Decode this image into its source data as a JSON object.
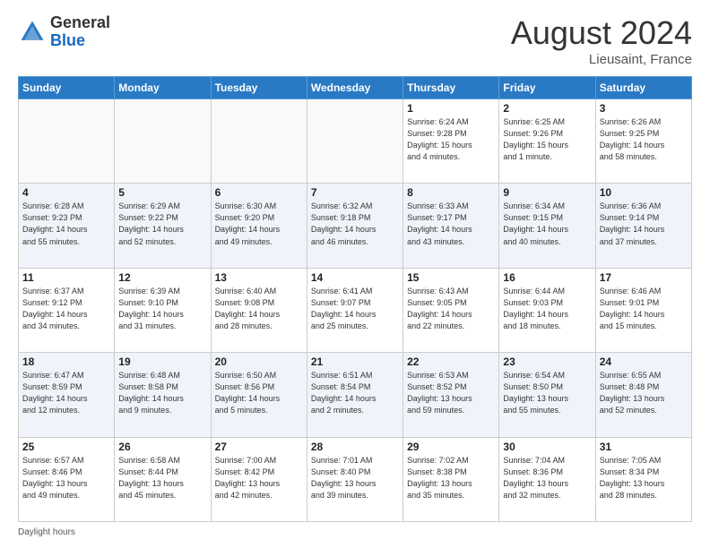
{
  "header": {
    "logo_general": "General",
    "logo_blue": "Blue",
    "month_title": "August 2024",
    "location": "Lieusaint, France"
  },
  "days_of_week": [
    "Sunday",
    "Monday",
    "Tuesday",
    "Wednesday",
    "Thursday",
    "Friday",
    "Saturday"
  ],
  "weeks": [
    [
      {
        "day": "",
        "info": ""
      },
      {
        "day": "",
        "info": ""
      },
      {
        "day": "",
        "info": ""
      },
      {
        "day": "",
        "info": ""
      },
      {
        "day": "1",
        "info": "Sunrise: 6:24 AM\nSunset: 9:28 PM\nDaylight: 15 hours\nand 4 minutes."
      },
      {
        "day": "2",
        "info": "Sunrise: 6:25 AM\nSunset: 9:26 PM\nDaylight: 15 hours\nand 1 minute."
      },
      {
        "day": "3",
        "info": "Sunrise: 6:26 AM\nSunset: 9:25 PM\nDaylight: 14 hours\nand 58 minutes."
      }
    ],
    [
      {
        "day": "4",
        "info": "Sunrise: 6:28 AM\nSunset: 9:23 PM\nDaylight: 14 hours\nand 55 minutes."
      },
      {
        "day": "5",
        "info": "Sunrise: 6:29 AM\nSunset: 9:22 PM\nDaylight: 14 hours\nand 52 minutes."
      },
      {
        "day": "6",
        "info": "Sunrise: 6:30 AM\nSunset: 9:20 PM\nDaylight: 14 hours\nand 49 minutes."
      },
      {
        "day": "7",
        "info": "Sunrise: 6:32 AM\nSunset: 9:18 PM\nDaylight: 14 hours\nand 46 minutes."
      },
      {
        "day": "8",
        "info": "Sunrise: 6:33 AM\nSunset: 9:17 PM\nDaylight: 14 hours\nand 43 minutes."
      },
      {
        "day": "9",
        "info": "Sunrise: 6:34 AM\nSunset: 9:15 PM\nDaylight: 14 hours\nand 40 minutes."
      },
      {
        "day": "10",
        "info": "Sunrise: 6:36 AM\nSunset: 9:14 PM\nDaylight: 14 hours\nand 37 minutes."
      }
    ],
    [
      {
        "day": "11",
        "info": "Sunrise: 6:37 AM\nSunset: 9:12 PM\nDaylight: 14 hours\nand 34 minutes."
      },
      {
        "day": "12",
        "info": "Sunrise: 6:39 AM\nSunset: 9:10 PM\nDaylight: 14 hours\nand 31 minutes."
      },
      {
        "day": "13",
        "info": "Sunrise: 6:40 AM\nSunset: 9:08 PM\nDaylight: 14 hours\nand 28 minutes."
      },
      {
        "day": "14",
        "info": "Sunrise: 6:41 AM\nSunset: 9:07 PM\nDaylight: 14 hours\nand 25 minutes."
      },
      {
        "day": "15",
        "info": "Sunrise: 6:43 AM\nSunset: 9:05 PM\nDaylight: 14 hours\nand 22 minutes."
      },
      {
        "day": "16",
        "info": "Sunrise: 6:44 AM\nSunset: 9:03 PM\nDaylight: 14 hours\nand 18 minutes."
      },
      {
        "day": "17",
        "info": "Sunrise: 6:46 AM\nSunset: 9:01 PM\nDaylight: 14 hours\nand 15 minutes."
      }
    ],
    [
      {
        "day": "18",
        "info": "Sunrise: 6:47 AM\nSunset: 8:59 PM\nDaylight: 14 hours\nand 12 minutes."
      },
      {
        "day": "19",
        "info": "Sunrise: 6:48 AM\nSunset: 8:58 PM\nDaylight: 14 hours\nand 9 minutes."
      },
      {
        "day": "20",
        "info": "Sunrise: 6:50 AM\nSunset: 8:56 PM\nDaylight: 14 hours\nand 5 minutes."
      },
      {
        "day": "21",
        "info": "Sunrise: 6:51 AM\nSunset: 8:54 PM\nDaylight: 14 hours\nand 2 minutes."
      },
      {
        "day": "22",
        "info": "Sunrise: 6:53 AM\nSunset: 8:52 PM\nDaylight: 13 hours\nand 59 minutes."
      },
      {
        "day": "23",
        "info": "Sunrise: 6:54 AM\nSunset: 8:50 PM\nDaylight: 13 hours\nand 55 minutes."
      },
      {
        "day": "24",
        "info": "Sunrise: 6:55 AM\nSunset: 8:48 PM\nDaylight: 13 hours\nand 52 minutes."
      }
    ],
    [
      {
        "day": "25",
        "info": "Sunrise: 6:57 AM\nSunset: 8:46 PM\nDaylight: 13 hours\nand 49 minutes."
      },
      {
        "day": "26",
        "info": "Sunrise: 6:58 AM\nSunset: 8:44 PM\nDaylight: 13 hours\nand 45 minutes."
      },
      {
        "day": "27",
        "info": "Sunrise: 7:00 AM\nSunset: 8:42 PM\nDaylight: 13 hours\nand 42 minutes."
      },
      {
        "day": "28",
        "info": "Sunrise: 7:01 AM\nSunset: 8:40 PM\nDaylight: 13 hours\nand 39 minutes."
      },
      {
        "day": "29",
        "info": "Sunrise: 7:02 AM\nSunset: 8:38 PM\nDaylight: 13 hours\nand 35 minutes."
      },
      {
        "day": "30",
        "info": "Sunrise: 7:04 AM\nSunset: 8:36 PM\nDaylight: 13 hours\nand 32 minutes."
      },
      {
        "day": "31",
        "info": "Sunrise: 7:05 AM\nSunset: 8:34 PM\nDaylight: 13 hours\nand 28 minutes."
      }
    ]
  ],
  "footer": {
    "label": "Daylight hours"
  }
}
